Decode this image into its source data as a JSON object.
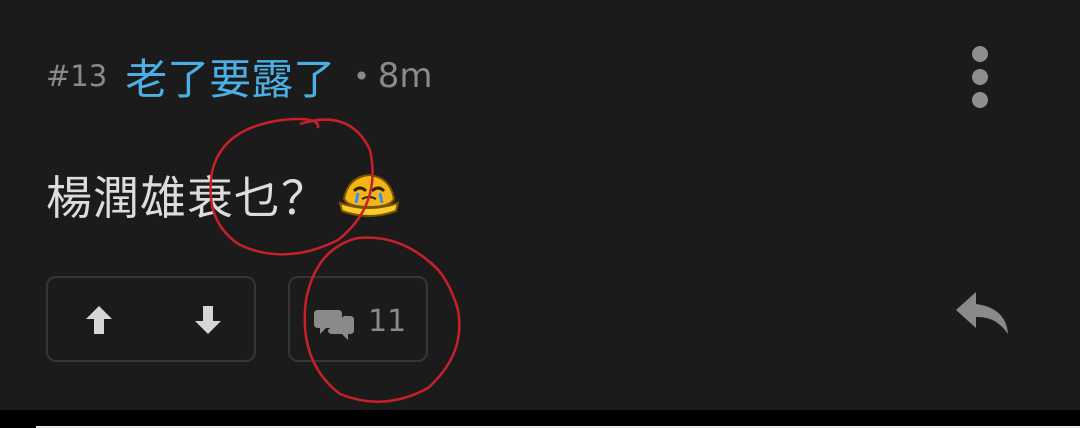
{
  "post": {
    "floor": "#13",
    "username": "老了要露了",
    "separator": "•",
    "time": "8m",
    "content": "楊潤雄衰乜？",
    "reply_count": "11"
  },
  "icons": {
    "more": "vertical-dots-icon",
    "upvote": "arrow-up-icon",
    "downvote": "arrow-down-icon",
    "comments": "chat-bubbles-icon",
    "reply": "reply-arrow-icon",
    "emoji": "crying-face-emoji"
  },
  "colors": {
    "background": "#1b1b1b",
    "username": "#4ab0e6",
    "annotation": "#c8202a"
  }
}
